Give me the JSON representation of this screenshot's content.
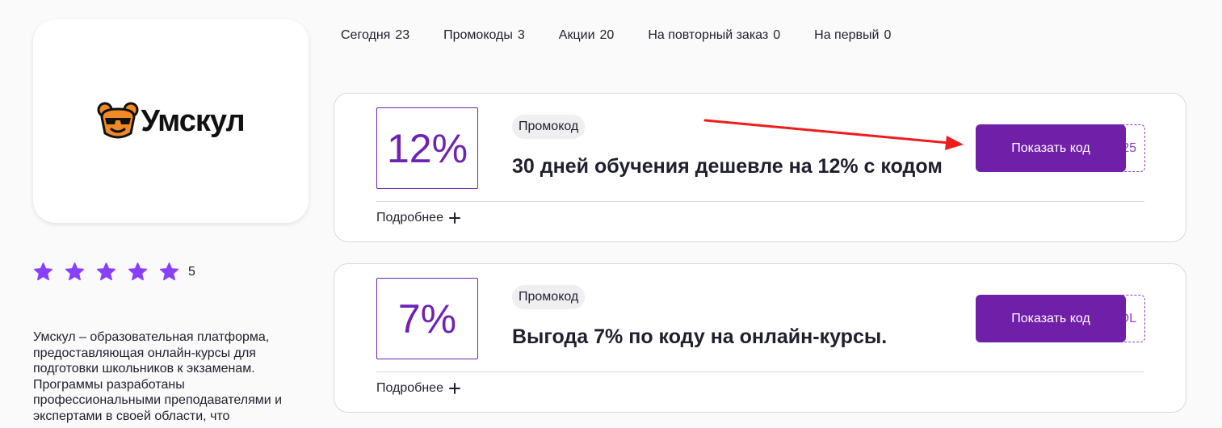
{
  "brand": {
    "name": "Умскул",
    "logo_icon": "bear-face-icon",
    "colors": {
      "accent": "#6f1fa8",
      "star": "#8a3ffc",
      "logo_orange": "#f08a24"
    }
  },
  "rating": {
    "stars": 5,
    "value": "5"
  },
  "description": "Умскул – образовательная платформа, предоставляющая онлайн-курсы для подготовки школьников к экзаменам. Программы разработаны профессиональными преподавателями и экспертами в своей области, что",
  "tabs": [
    {
      "label": "Сегодня",
      "count": "23"
    },
    {
      "label": "Промокоды",
      "count": "3"
    },
    {
      "label": "Акции",
      "count": "20"
    },
    {
      "label": "На повторный заказ",
      "count": "0"
    },
    {
      "label": "На первый",
      "count": "0"
    }
  ],
  "coupons": [
    {
      "discount": "12%",
      "badge": "Промокод",
      "title": "30 дней обучения дешевле на 12% с кодом",
      "code_tail": "25",
      "button_label": "Показать код",
      "more_label": "Подробнее"
    },
    {
      "discount": "7%",
      "badge": "Промокод",
      "title": "Выгода 7% по коду на онлайн-курсы.",
      "code_tail": "OL",
      "button_label": "Показать код",
      "more_label": "Подробнее"
    }
  ]
}
